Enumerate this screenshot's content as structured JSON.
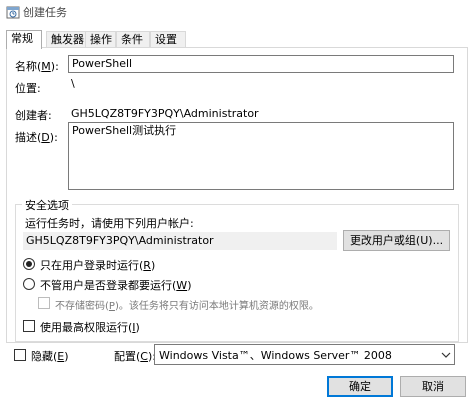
{
  "window": {
    "title": "创建任务",
    "icon": "task-scheduler-icon"
  },
  "tabs": [
    {
      "label": "常规",
      "active": true
    },
    {
      "label": "触发器",
      "active": false
    },
    {
      "label": "操作",
      "active": false
    },
    {
      "label": "条件",
      "active": false
    },
    {
      "label": "设置",
      "active": false
    }
  ],
  "general": {
    "name_label": "名称(",
    "name_key": "M",
    "name_suffix": "):",
    "name_value": "PowerShell",
    "location_label": "位置:",
    "location_value": "\\",
    "author_label": "创建者:",
    "author_value": "GH5LQZ8T9FY3PQY\\Administrator",
    "description_label": "描述(",
    "description_key": "D",
    "description_suffix": "):",
    "description_value": "PowerShell测试执行"
  },
  "security": {
    "group_title": "安全选项",
    "run_as_prompt": "运行任务时，请使用下列用户帐户:",
    "user_account": "GH5LQZ8T9FY3PQY\\Administrator",
    "change_user_button": "更改用户或组(U)...",
    "radio_logged_on_prefix": "只在用户登录时运行(",
    "radio_logged_on_key": "R",
    "radio_logged_on_suffix": ")",
    "radio_logged_on_checked": true,
    "radio_whether_prefix": "不管用户是否登录都要运行(",
    "radio_whether_key": "W",
    "radio_whether_suffix": ")",
    "radio_whether_checked": false,
    "no_store_password_prefix": "不存储密码(",
    "no_store_password_key": "P",
    "no_store_password_suffix": ")。该任务将只有访问本地计算机资源的权限。",
    "highest_privileges_prefix": "使用最高权限运行(",
    "highest_privileges_key": "I",
    "highest_privileges_suffix": ")"
  },
  "footer": {
    "hidden_prefix": "隐藏(",
    "hidden_key": "E",
    "hidden_suffix": ")",
    "configure_prefix": "配置(",
    "configure_key": "C",
    "configure_suffix": "):",
    "configure_value": "Windows Vista™、Windows Server™ 2008",
    "ok_button": "确定",
    "cancel_button": "取消"
  },
  "colors": {
    "accent": "#0078d7",
    "tab_inactive": "#f0f0f0",
    "readonly_bg": "#f0f0f0"
  }
}
